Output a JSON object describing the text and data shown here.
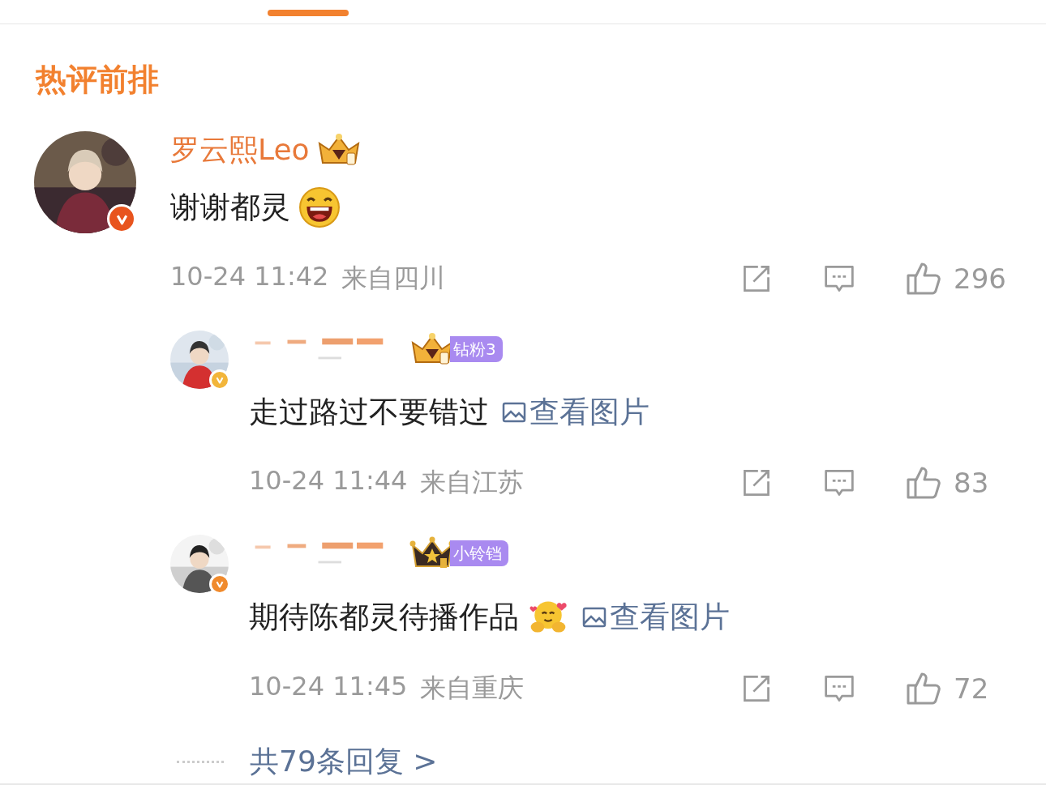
{
  "section_title": "热评前排",
  "comments": [
    {
      "kind": "main",
      "author": "罗云熙Leo",
      "verified": {
        "color": "#e8541e"
      },
      "crown": {
        "kind": "gold"
      },
      "text": "谢谢都灵",
      "emoji": {
        "kind": "laugh"
      },
      "time": "10-24 11:42",
      "location": "来自四川",
      "likes": "296"
    },
    {
      "kind": "reply",
      "verified": {
        "color": "#f2b53a"
      },
      "crown": {
        "kind": "gold"
      },
      "badge": "钻粉3",
      "text": "走过路过不要错过",
      "image_link": "查看图片",
      "time": "10-24 11:44",
      "location": "来自江苏",
      "likes": "83"
    },
    {
      "kind": "reply",
      "verified": {
        "color": "#f08a2c"
      },
      "crown": {
        "kind": "dark"
      },
      "badge": "小铃铛",
      "text": "期待陈都灵待播作品",
      "emoji": {
        "kind": "hug"
      },
      "image_link": "查看图片",
      "time": "10-24 11:45",
      "location": "来自重庆",
      "likes": "72"
    }
  ],
  "more_replies": "共79条回复 >"
}
